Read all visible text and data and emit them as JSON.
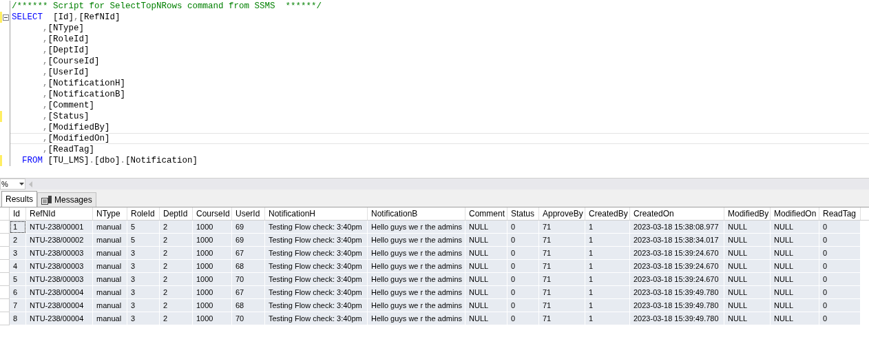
{
  "editor": {
    "lines": [
      {
        "changed": false,
        "current": false,
        "collapsible": false,
        "tokens": [
          {
            "kind": "comment",
            "text": "/****** Script for SelectTopNRows command from SSMS  ******/"
          }
        ]
      },
      {
        "changed": true,
        "current": false,
        "collapsible": true,
        "tokens": [
          {
            "kind": "keyword",
            "text": "SELECT"
          },
          {
            "kind": "ident",
            "text": "  [Id]"
          },
          {
            "kind": "punct",
            "text": ","
          },
          {
            "kind": "ident",
            "text": "[RefNId]"
          }
        ]
      },
      {
        "changed": false,
        "current": false,
        "collapsible": false,
        "tokens": [
          {
            "kind": "punct",
            "text": "      ,"
          },
          {
            "kind": "ident",
            "text": "[NType]"
          }
        ]
      },
      {
        "changed": false,
        "current": false,
        "collapsible": false,
        "tokens": [
          {
            "kind": "punct",
            "text": "      ,"
          },
          {
            "kind": "ident",
            "text": "[RoleId]"
          }
        ]
      },
      {
        "changed": false,
        "current": false,
        "collapsible": false,
        "tokens": [
          {
            "kind": "punct",
            "text": "      ,"
          },
          {
            "kind": "ident",
            "text": "[DeptId]"
          }
        ]
      },
      {
        "changed": false,
        "current": false,
        "collapsible": false,
        "tokens": [
          {
            "kind": "punct",
            "text": "      ,"
          },
          {
            "kind": "ident",
            "text": "[CourseId]"
          }
        ]
      },
      {
        "changed": false,
        "current": false,
        "collapsible": false,
        "tokens": [
          {
            "kind": "punct",
            "text": "      ,"
          },
          {
            "kind": "ident",
            "text": "[UserId]"
          }
        ]
      },
      {
        "changed": false,
        "current": false,
        "collapsible": false,
        "tokens": [
          {
            "kind": "punct",
            "text": "      ,"
          },
          {
            "kind": "ident",
            "text": "[NotificationH]"
          }
        ]
      },
      {
        "changed": false,
        "current": false,
        "collapsible": false,
        "tokens": [
          {
            "kind": "punct",
            "text": "      ,"
          },
          {
            "kind": "ident",
            "text": "[NotificationB]"
          }
        ]
      },
      {
        "changed": false,
        "current": false,
        "collapsible": false,
        "tokens": [
          {
            "kind": "punct",
            "text": "      ,"
          },
          {
            "kind": "ident",
            "text": "[Comment]"
          }
        ]
      },
      {
        "changed": true,
        "current": false,
        "collapsible": false,
        "tokens": [
          {
            "kind": "punct",
            "text": "      ,"
          },
          {
            "kind": "ident",
            "text": "[Status]"
          }
        ]
      },
      {
        "changed": false,
        "current": false,
        "collapsible": false,
        "tokens": [
          {
            "kind": "punct",
            "text": "      ,"
          },
          {
            "kind": "ident",
            "text": "[ModifiedBy]"
          }
        ]
      },
      {
        "changed": false,
        "current": true,
        "collapsible": false,
        "tokens": [
          {
            "kind": "punct",
            "text": "      ,"
          },
          {
            "kind": "ident",
            "text": "[ModifiedOn]"
          }
        ]
      },
      {
        "changed": false,
        "current": false,
        "collapsible": false,
        "tokens": [
          {
            "kind": "punct",
            "text": "      ,"
          },
          {
            "kind": "ident",
            "text": "[ReadTag]"
          }
        ]
      },
      {
        "changed": true,
        "current": false,
        "collapsible": false,
        "tokens": [
          {
            "kind": "keyword",
            "text": "  FROM"
          },
          {
            "kind": "ident",
            "text": " [TU_LMS]"
          },
          {
            "kind": "punct",
            "text": "."
          },
          {
            "kind": "ident",
            "text": "[dbo]"
          },
          {
            "kind": "punct",
            "text": "."
          },
          {
            "kind": "ident",
            "text": "[Notification]"
          }
        ]
      }
    ]
  },
  "zoom": "%",
  "tabs": [
    {
      "label": "Results",
      "selected": true
    },
    {
      "label": "Messages",
      "selected": false
    }
  ],
  "table": {
    "columns": [
      "Id",
      "RefNId",
      "NType",
      "RoleId",
      "DeptId",
      "CourseId",
      "UserId",
      "NotificationH",
      "NotificationB",
      "Comment",
      "Status",
      "ApproveBy",
      "CreatedBy",
      "CreatedOn",
      "ModifiedBy",
      "ModifiedOn",
      "ReadTag"
    ],
    "rows": [
      {
        "focused": true,
        "cells": [
          "1",
          "NTU-238/00001",
          "manual",
          "5",
          "2",
          "1000",
          "69",
          "Testing Flow check: 3:40pm",
          "Hello guys we r the admins",
          "NULL",
          "0",
          "71",
          "1",
          "2023-03-18 15:38:08.977",
          "NULL",
          "NULL",
          "0"
        ]
      },
      {
        "focused": false,
        "cells": [
          "2",
          "NTU-238/00002",
          "manual",
          "5",
          "2",
          "1000",
          "69",
          "Testing Flow check: 3:40pm",
          "Hello guys we r the admins",
          "NULL",
          "0",
          "71",
          "1",
          "2023-03-18 15:38:34.017",
          "NULL",
          "NULL",
          "0"
        ]
      },
      {
        "focused": false,
        "cells": [
          "3",
          "NTU-238/00003",
          "manual",
          "3",
          "2",
          "1000",
          "67",
          "Testing Flow check: 3:40pm",
          "Hello guys we r the admins",
          "NULL",
          "0",
          "71",
          "1",
          "2023-03-18 15:39:24.670",
          "NULL",
          "NULL",
          "0"
        ]
      },
      {
        "focused": false,
        "cells": [
          "4",
          "NTU-238/00003",
          "manual",
          "3",
          "2",
          "1000",
          "68",
          "Testing Flow check: 3:40pm",
          "Hello guys we r the admins",
          "NULL",
          "0",
          "71",
          "1",
          "2023-03-18 15:39:24.670",
          "NULL",
          "NULL",
          "0"
        ]
      },
      {
        "focused": false,
        "cells": [
          "5",
          "NTU-238/00003",
          "manual",
          "3",
          "2",
          "1000",
          "70",
          "Testing Flow check: 3:40pm",
          "Hello guys we r the admins",
          "NULL",
          "0",
          "71",
          "1",
          "2023-03-18 15:39:24.670",
          "NULL",
          "NULL",
          "0"
        ]
      },
      {
        "focused": false,
        "cells": [
          "6",
          "NTU-238/00004",
          "manual",
          "3",
          "2",
          "1000",
          "67",
          "Testing Flow check: 3:40pm",
          "Hello guys we r the admins",
          "NULL",
          "0",
          "71",
          "1",
          "2023-03-18 15:39:49.780",
          "NULL",
          "NULL",
          "0"
        ]
      },
      {
        "focused": false,
        "cells": [
          "7",
          "NTU-238/00004",
          "manual",
          "3",
          "2",
          "1000",
          "68",
          "Testing Flow check: 3:40pm",
          "Hello guys we r the admins",
          "NULL",
          "0",
          "71",
          "1",
          "2023-03-18 15:39:49.780",
          "NULL",
          "NULL",
          "0"
        ]
      },
      {
        "focused": false,
        "cells": [
          "8",
          "NTU-238/00004",
          "manual",
          "3",
          "2",
          "1000",
          "70",
          "Testing Flow check: 3:40pm",
          "Hello guys we r the admins",
          "NULL",
          "0",
          "71",
          "1",
          "2023-03-18 15:39:49.780",
          "NULL",
          "NULL",
          "0"
        ]
      }
    ]
  }
}
